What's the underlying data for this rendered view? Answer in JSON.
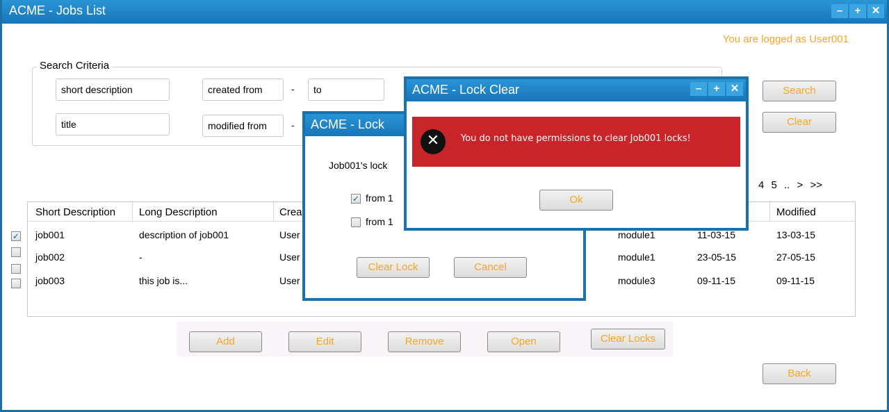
{
  "window": {
    "title": "ACME - Jobs List",
    "controls": [
      "–",
      "+",
      "✕"
    ]
  },
  "user": {
    "logged_text": "You are logged as User001"
  },
  "search": {
    "legend": "Search Criteria",
    "short_description": "short description",
    "title": "title",
    "created_from": "created from",
    "to": "to",
    "modified_from": "modified from",
    "dash": "-",
    "search_label": "Search",
    "clear_label": "Clear"
  },
  "pager": {
    "text": "4 5 .. > >>"
  },
  "table": {
    "headers": [
      "Short Description",
      "Long Description",
      "Crea",
      "Modified"
    ],
    "rows": [
      {
        "checked": true,
        "short": "job001",
        "long": "description of job001",
        "creator": "User",
        "module": "module1",
        "created": "11-03-15",
        "modified": "13-03-15"
      },
      {
        "checked": false,
        "short": "job002",
        "long": "-",
        "creator": "User",
        "module": "module1",
        "created": "23-05-15",
        "modified": "27-05-15"
      },
      {
        "checked": false,
        "short": "job003",
        "long": "this job is...",
        "creator": "User",
        "module": "module3",
        "created": "09-11-15",
        "modified": "09-11-15"
      }
    ]
  },
  "actions": {
    "add": "Add",
    "edit": "Edit",
    "remove": "Remove",
    "open": "Open",
    "clear_locks": "Clear Locks",
    "back": "Back"
  },
  "lock_dialog": {
    "title": "ACME - Lock",
    "message": "Job001's lock",
    "options": [
      {
        "label": "from 1",
        "checked": true
      },
      {
        "label": "from 1",
        "checked": false
      }
    ],
    "clear_lock": "Clear Lock",
    "cancel": "Cancel"
  },
  "lock_clear_dialog": {
    "title": "ACME - Lock Clear",
    "error_message": "You do not have permissions to clear Job001 locks!",
    "ok": "Ok"
  },
  "colors": {
    "accent": "#1875b8",
    "button_text": "#f5a623",
    "error": "#c8252a"
  }
}
